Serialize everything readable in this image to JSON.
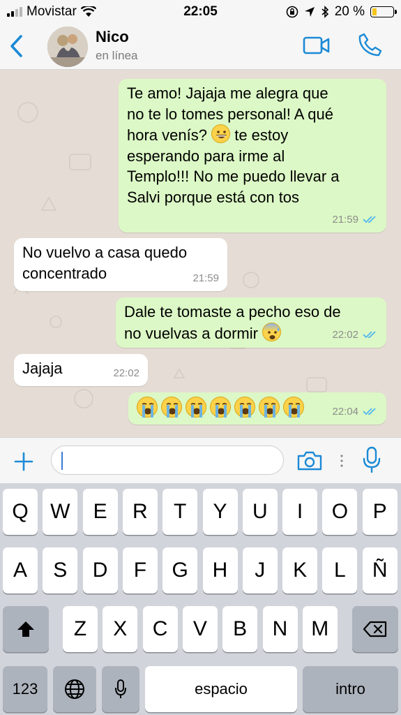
{
  "status_bar": {
    "carrier": "Movistar",
    "time": "22:05",
    "battery_text": "20 %",
    "battery_level": 0.2,
    "icons": [
      "signal-icon",
      "wifi-icon",
      "rotation-lock-icon",
      "location-icon",
      "bluetooth-icon",
      "battery-icon"
    ]
  },
  "header": {
    "contact_name": "Nico",
    "contact_status": "en línea",
    "icons": [
      "back-chevron-icon",
      "avatar",
      "video-call-icon",
      "phone-icon"
    ],
    "accent_color": "#1a8ad6"
  },
  "messages": [
    {
      "direction": "out",
      "lines": [
        "Te amo! Jajaja me alegra que",
        "no te lo tomes personal! A qué",
        "hora venís?",
        "esperando para irme al",
        "Templo!!! No me puedo llevar a",
        "Salvi porque está con tos"
      ],
      "line3_tail": "te estoy",
      "emoji": "grinning-face",
      "time": "21:59",
      "status": "read"
    },
    {
      "direction": "in",
      "lines": [
        "No vuelvo a casa quedo",
        "concentrado"
      ],
      "time": "21:59"
    },
    {
      "direction": "out",
      "lines": [
        "Dale te tomaste a pecho eso de",
        "no vuelvas a dormir"
      ],
      "emoji": "anxious-face-with-sweat",
      "time": "22:02",
      "status": "read"
    },
    {
      "direction": "in",
      "lines": [
        "Jajaja"
      ],
      "time": "22:02"
    },
    {
      "direction": "out",
      "emoji_only": "loudly-crying-face",
      "emoji_count": 7,
      "time": "22:04",
      "status": "read"
    }
  ],
  "input_bar": {
    "placeholder": "",
    "value": "",
    "icons": [
      "plus-icon",
      "camera-icon",
      "more-dots-icon",
      "microphone-icon"
    ]
  },
  "keyboard": {
    "row1": [
      "Q",
      "W",
      "E",
      "R",
      "T",
      "Y",
      "U",
      "I",
      "O",
      "P"
    ],
    "row2": [
      "A",
      "S",
      "D",
      "F",
      "G",
      "H",
      "J",
      "K",
      "L",
      "Ñ"
    ],
    "row3": [
      "Z",
      "X",
      "C",
      "V",
      "B",
      "N",
      "M"
    ],
    "numbers_label": "123",
    "space_label": "espacio",
    "return_label": "intro",
    "icons": [
      "shift-icon",
      "backspace-icon",
      "globe-icon",
      "keyboard-mic-icon"
    ]
  },
  "colors": {
    "outgoing_bubble": "#dcf8c6",
    "incoming_bubble": "#ffffff",
    "read_ticks": "#4fb6ec",
    "chat_background": "#e5ddd5"
  }
}
